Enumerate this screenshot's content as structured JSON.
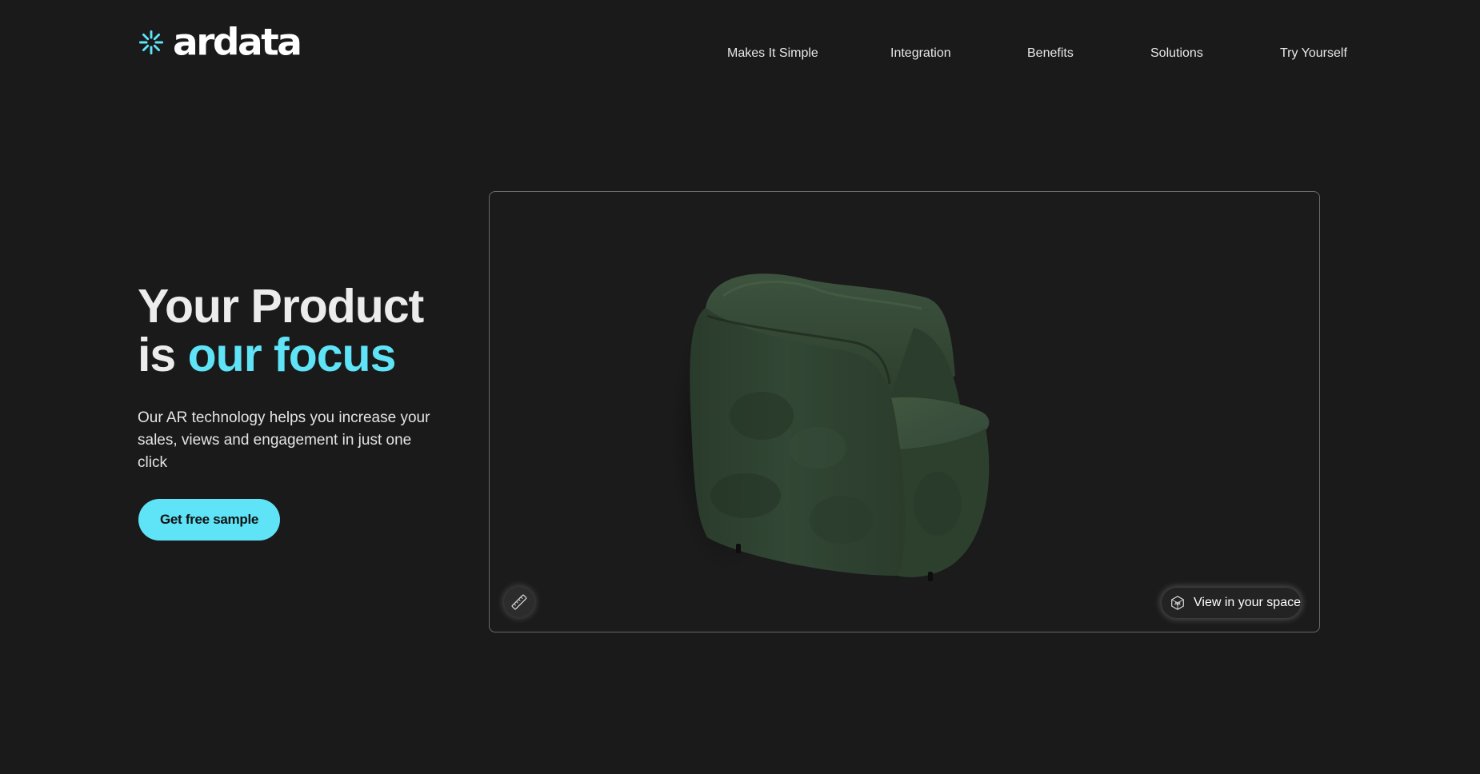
{
  "header": {
    "logo_text": "ardata",
    "nav": [
      "Makes It Simple",
      "Integration",
      "Benefits",
      "Solutions",
      "Try Yourself"
    ]
  },
  "hero": {
    "title_line1": "Your Product",
    "title_line2_prefix": "is ",
    "title_line2_accent": "our focus",
    "subtitle": "Our AR technology helps you increase your sales, views and engagement in just one click",
    "cta_label": "Get free sample"
  },
  "viewer": {
    "ar_button_label": "View in your space",
    "ar_icon": "ar-cube-icon",
    "measure_icon": "ruler-icon"
  },
  "colors": {
    "background": "#1a1a1a",
    "accent": "#5fe3f6",
    "chair": "#2f4230"
  }
}
